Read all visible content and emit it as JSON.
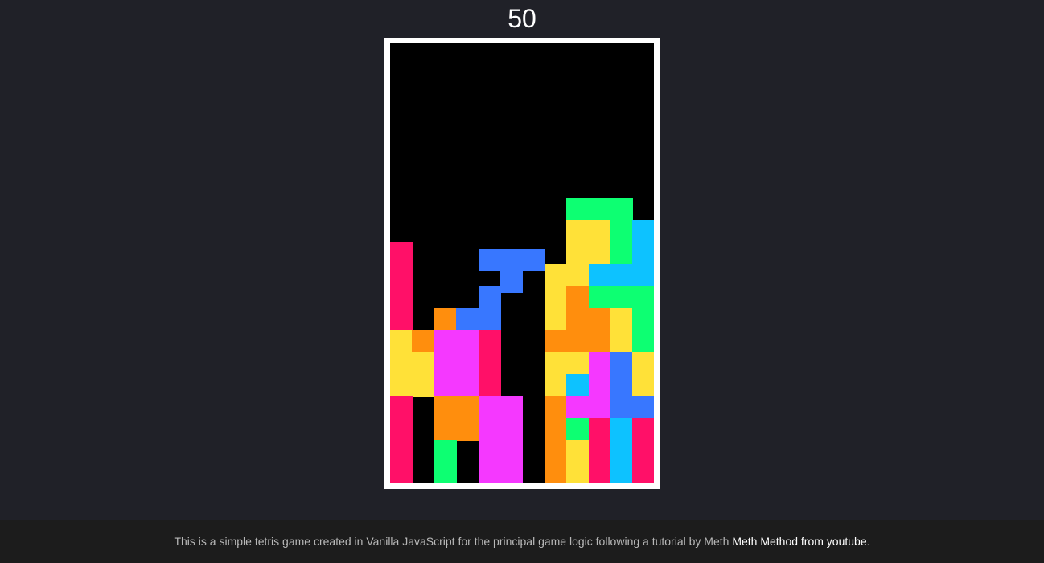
{
  "score": "50",
  "colors": {
    "M": "#ff1068",
    "O": "#ff8e0d",
    "Y": "#ffe138",
    "P": "#f538ff",
    "B": "#3877ff",
    "G": "#0dff72",
    "C": "#0dc2ff"
  },
  "board": {
    "columns": 12,
    "rows": 20,
    "grid": [
      "............",
      "............",
      "............",
      "............",
      "............",
      "............",
      "............",
      "............",
      "............",
      "............",
      "............",
      "........GGG.",
      "........YYGC",
      "M.......YYGC",
      "M......YYCCC",
      "M...B..YOGGG",
      "M.OBB..YOOYG",
      "YOPPM..OOOYG",
      "YYPPM..YYPBY",
      "YYPPM..YCPBY",
      "M.OOPP.OPPBB",
      "M.OOPP.OGMCM",
      "M.G.PP.OYMCM",
      "M.G.PP.OYMCM"
    ],
    "active_piece": {
      "shape": "T",
      "color": "B",
      "cells": [
        [
          4,
          9
        ],
        [
          5,
          9
        ],
        [
          6,
          9
        ],
        [
          5,
          10
        ]
      ]
    }
  },
  "footer": {
    "text": "This is a simple tetris game created in Vanilla JavaScript for the principal game logic following a tutorial by Meth ",
    "link_label": "Meth Method from youtube",
    "suffix": "."
  }
}
